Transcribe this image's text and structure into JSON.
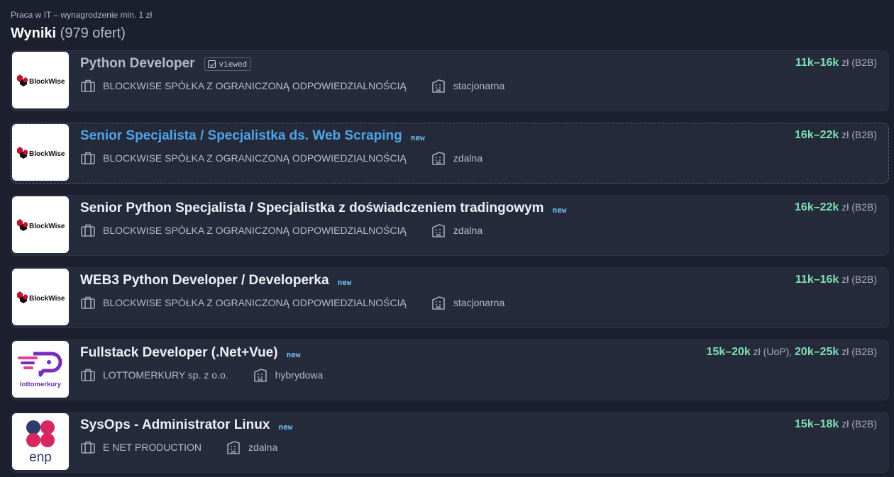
{
  "breadcrumb": "Praca w IT – wynagrodzenie min. 1 zł",
  "results": {
    "label": "Wyniki",
    "count": "(979 ofert)"
  },
  "offers": [
    {
      "title": "Python Developer",
      "badge": "viewed",
      "company": "BLOCKWISE SPÓŁKA Z OGRANICZONĄ ODPOWIEDZIALNOŚCIĄ",
      "work_mode": "stacjonarna",
      "salary": [
        {
          "range": "11k–16k",
          "unit": "zł (B2B)"
        }
      ],
      "logo_text": "BlockWise"
    },
    {
      "title": "Senior Specjalista / Specjalistka ds. Web Scraping",
      "badge": "new",
      "company": "BLOCKWISE SPÓŁKA Z OGRANICZONĄ ODPOWIEDZIALNOŚCIĄ",
      "work_mode": "zdalna",
      "salary": [
        {
          "range": "16k–22k",
          "unit": "zł (B2B)"
        }
      ],
      "logo_text": "BlockWise"
    },
    {
      "title": "Senior Python Specjalista / Specjalistka z doświadczeniem tradingowym",
      "badge": "new",
      "company": "BLOCKWISE SPÓŁKA Z OGRANICZONĄ ODPOWIEDZIALNOŚCIĄ",
      "work_mode": "zdalna",
      "salary": [
        {
          "range": "16k–22k",
          "unit": "zł (B2B)"
        }
      ],
      "logo_text": "BlockWise"
    },
    {
      "title": "WEB3 Python Developer / Developerka",
      "badge": "new",
      "company": "BLOCKWISE SPÓŁKA Z OGRANICZONĄ ODPOWIEDZIALNOŚCIĄ",
      "work_mode": "stacjonarna",
      "salary": [
        {
          "range": "11k–16k",
          "unit": "zł (B2B)"
        }
      ],
      "logo_text": "BlockWise"
    },
    {
      "title": "Fullstack Developer (.Net+Vue)",
      "badge": "new",
      "company": "LOTTOMERKURY sp. z o.o.",
      "work_mode": "hybrydowa",
      "salary": [
        {
          "range": "15k–20k",
          "unit": "zł (UoP),"
        },
        {
          "range": "20k–25k",
          "unit": "zł (B2B)"
        }
      ],
      "logo_text": "lottomerkury"
    },
    {
      "title": "SysOps - Administrator Linux",
      "badge": "new",
      "company": "E NET PRODUCTION",
      "work_mode": "zdalna",
      "salary": [
        {
          "range": "15k–18k",
          "unit": "zł (B2B)"
        }
      ],
      "logo_text": "enp"
    }
  ],
  "colors": {
    "background": "#1b1f2e",
    "card": "#262b3c",
    "salary": "#7fe0b2",
    "link_title": "#4ea6e6",
    "new_tag": "#6ec2f2"
  }
}
